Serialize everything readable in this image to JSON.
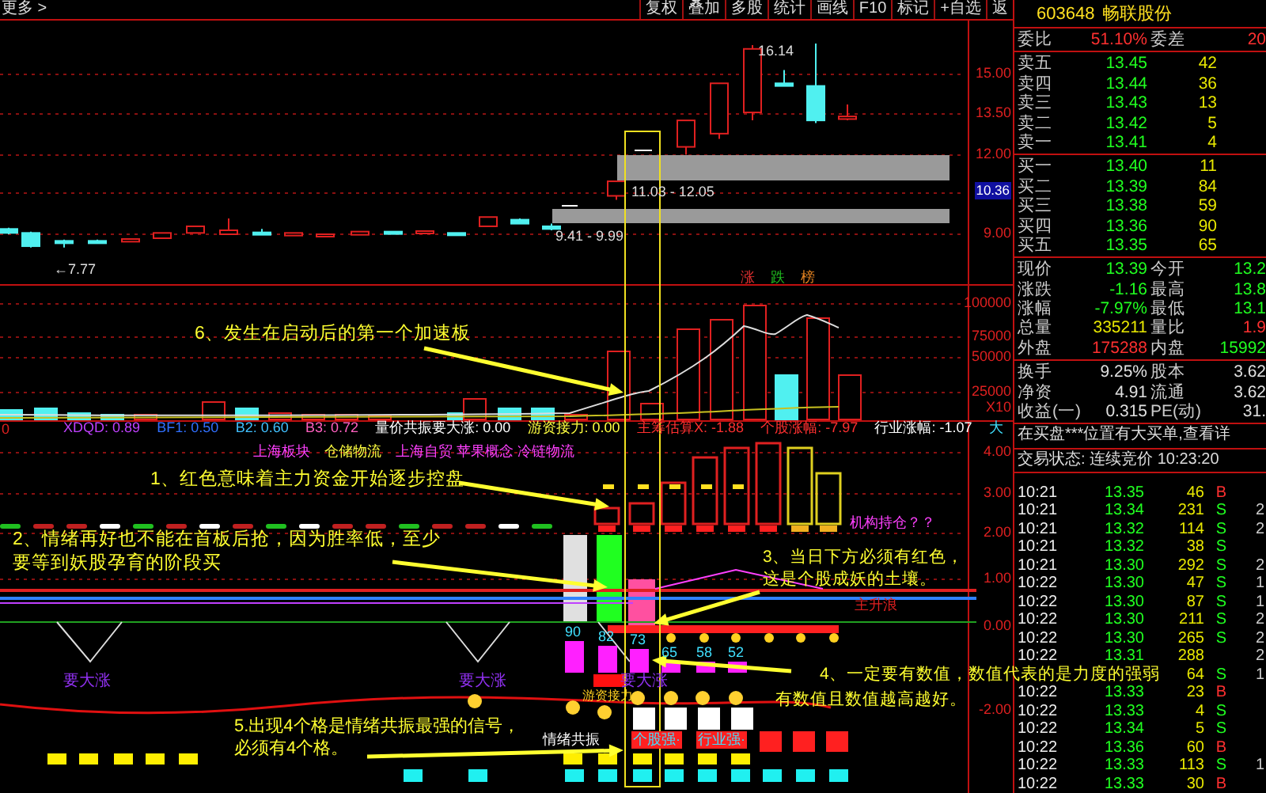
{
  "toolbar": {
    "more": "更多 >",
    "buttons": [
      "复权",
      "叠加",
      "多股",
      "统计",
      "画线",
      "F10",
      "标记",
      "+自选",
      "返"
    ]
  },
  "price_chart": {
    "axis": [
      "15.00",
      "13.50",
      "12.00",
      "9.00"
    ],
    "current_price": "10.36",
    "high_label": "16.14",
    "low_label": "←7.77",
    "bands": [
      "11.03 - 12.05",
      "9.41 - 9.99"
    ],
    "rank_tags": [
      {
        "text": "涨",
        "color": "#e03030"
      },
      {
        "text": "跌",
        "color": "#20c020"
      },
      {
        "text": "榜",
        "color": "#e08020"
      }
    ]
  },
  "volume_chart": {
    "axis": [
      "100000",
      "75000",
      "50000",
      "25000",
      "X10"
    ]
  },
  "indicator_prefix": "0",
  "indicators": [
    {
      "text": "XDQD: 0.89",
      "color": "#c040ff"
    },
    {
      "text": "BF1: 0.50",
      "color": "#3070ff"
    },
    {
      "text": "B2: 0.60",
      "color": "#40c0ff"
    },
    {
      "text": "B3: 0.72",
      "color": "#ff60c0"
    },
    {
      "text": "量价共振要大涨: 0.00",
      "color": "#ffffff"
    },
    {
      "text": "游资接力: 0.00",
      "color": "#ffff40"
    },
    {
      "text": "主筹估算X: -1.88",
      "color": "#ff3030"
    },
    {
      "text": "个股涨幅: -7.97",
      "color": "#ff3030"
    },
    {
      "text": "行业涨幅: -1.07",
      "color": "#ffffff"
    },
    {
      "text": "大",
      "color": "#40e0ff"
    }
  ],
  "sectors": [
    {
      "text": "上海板块",
      "color": "#ff40ff"
    },
    {
      "text": "仓储物流",
      "color": "#ffff40"
    },
    {
      "text": "上海自贸 苹果概念 冷链物流",
      "color": "#ff40ff"
    }
  ],
  "lower_axis": [
    "4.00",
    "3.00",
    "2.00",
    "1.00",
    "0.00",
    "-2.00"
  ],
  "holding_label": "机构持仓？？",
  "trend_label": "主升浪",
  "rise_labels": [
    "要大涨",
    "要大涨",
    "要大涨"
  ],
  "strength_values": [
    "90",
    "82",
    "73",
    "65",
    "58",
    "52"
  ],
  "relay_label": "游资接力",
  "grid_labels": [
    "情绪共振",
    "个股强·",
    "行业强·"
  ],
  "annotations": [
    "6、发生在启动后的第一个加速板",
    "1、红色意味着主力资金开始逐步控盘",
    "2、情绪再好也不能在首板后抢，因为胜率低，至少要等到妖股孕育的阶段买",
    "3、当日下方必须有红色，这是个股成妖的土壤。",
    "4、一定要有数值，数值代表的是力度的强弱",
    "有数值且数值越高越好。",
    "5.出现4个格是情绪共振最强的信号，",
    "必须有4个格。"
  ],
  "quote": {
    "code": "603648",
    "name": "畅联股份",
    "ratio": {
      "label": "委比",
      "value": "51.10%",
      "diff_label": "委差",
      "diff": "20"
    },
    "asks": [
      {
        "label": "卖五",
        "price": "13.45",
        "volume": "42"
      },
      {
        "label": "卖四",
        "price": "13.44",
        "volume": "36"
      },
      {
        "label": "卖三",
        "price": "13.43",
        "volume": "13"
      },
      {
        "label": "卖二",
        "price": "13.42",
        "volume": "5"
      },
      {
        "label": "卖一",
        "price": "13.41",
        "volume": "4"
      }
    ],
    "bids": [
      {
        "label": "买一",
        "price": "13.40",
        "volume": "11"
      },
      {
        "label": "买二",
        "price": "13.39",
        "volume": "84"
      },
      {
        "label": "买三",
        "price": "13.38",
        "volume": "59"
      },
      {
        "label": "买四",
        "price": "13.36",
        "volume": "90"
      },
      {
        "label": "买五",
        "price": "13.35",
        "volume": "65"
      }
    ],
    "stats": [
      {
        "label": "现价",
        "value": "13.39",
        "kind": "down"
      },
      {
        "label": "今开",
        "value": "13.2",
        "kind": "down"
      },
      {
        "label": "涨跌",
        "value": "-1.16",
        "kind": "down"
      },
      {
        "label": "最高",
        "value": "13.8",
        "kind": "down"
      },
      {
        "label": "涨幅",
        "value": "-7.97%",
        "kind": "down"
      },
      {
        "label": "最低",
        "value": "13.1",
        "kind": "down"
      },
      {
        "label": "总量",
        "value": "335211",
        "kind": "volume"
      },
      {
        "label": "量比",
        "value": "1.9",
        "kind": "up"
      },
      {
        "label": "外盘",
        "value": "175288",
        "kind": "up"
      },
      {
        "label": "内盘",
        "value": "15992",
        "kind": "down"
      },
      {
        "label": "换手",
        "value": "9.25%",
        "kind": "neutral"
      },
      {
        "label": "股本",
        "value": "3.62",
        "kind": "neutral"
      },
      {
        "label": "净资",
        "value": "4.91",
        "kind": "neutral"
      },
      {
        "label": "流通",
        "value": "3.62",
        "kind": "neutral"
      },
      {
        "label": "收益(一)",
        "value": "0.315",
        "kind": "neutral"
      },
      {
        "label": "PE(动)",
        "value": "31.",
        "kind": "neutral"
      }
    ],
    "notice": "在买盘***位置有大买单,查看详",
    "status": "交易状态: 连续竞价 10:23:20"
  },
  "trades": [
    {
      "time": "10:21",
      "price": "13.35",
      "volume": "46",
      "side": "B",
      "kind": "buy"
    },
    {
      "time": "10:21",
      "price": "13.34",
      "volume": "231",
      "side": "S",
      "kind": "sell",
      "count": "2"
    },
    {
      "time": "10:21",
      "price": "13.32",
      "volume": "114",
      "side": "S",
      "kind": "sell",
      "count": "2"
    },
    {
      "time": "10:21",
      "price": "13.32",
      "volume": "38",
      "side": "S",
      "kind": "sell"
    },
    {
      "time": "10:21",
      "price": "13.30",
      "volume": "292",
      "side": "S",
      "kind": "sell",
      "count": "2"
    },
    {
      "time": "10:22",
      "price": "13.30",
      "volume": "47",
      "side": "S",
      "kind": "sell",
      "count": "1"
    },
    {
      "time": "10:22",
      "price": "13.30",
      "volume": "87",
      "side": "S",
      "kind": "sell",
      "count": "1"
    },
    {
      "time": "10:22",
      "price": "13.30",
      "volume": "211",
      "side": "S",
      "kind": "sell",
      "count": "2"
    },
    {
      "time": "10:22",
      "price": "13.30",
      "volume": "265",
      "side": "S",
      "kind": "sell",
      "count": "2"
    },
    {
      "time": "10:22",
      "price": "13.31",
      "volume": "288",
      "count": "2"
    },
    {
      "volume": "64",
      "side": "S",
      "kind": "sell",
      "count": "1"
    },
    {
      "time": "10:22",
      "price": "13.33",
      "volume": "23",
      "side": "B",
      "kind": "buy"
    },
    {
      "time": "10:22",
      "price": "13.33",
      "volume": "4",
      "side": "S",
      "kind": "sell"
    },
    {
      "time": "10:22",
      "price": "13.34",
      "volume": "5",
      "side": "S",
      "kind": "sell"
    },
    {
      "time": "10:22",
      "price": "13.36",
      "volume": "60",
      "side": "B",
      "kind": "buy"
    },
    {
      "time": "10:22",
      "price": "13.33",
      "volume": "113",
      "side": "S",
      "kind": "sell",
      "count": "1"
    },
    {
      "time": "10:22",
      "price": "13.33",
      "volume": "30",
      "side": "B",
      "kind": "buy"
    }
  ]
}
